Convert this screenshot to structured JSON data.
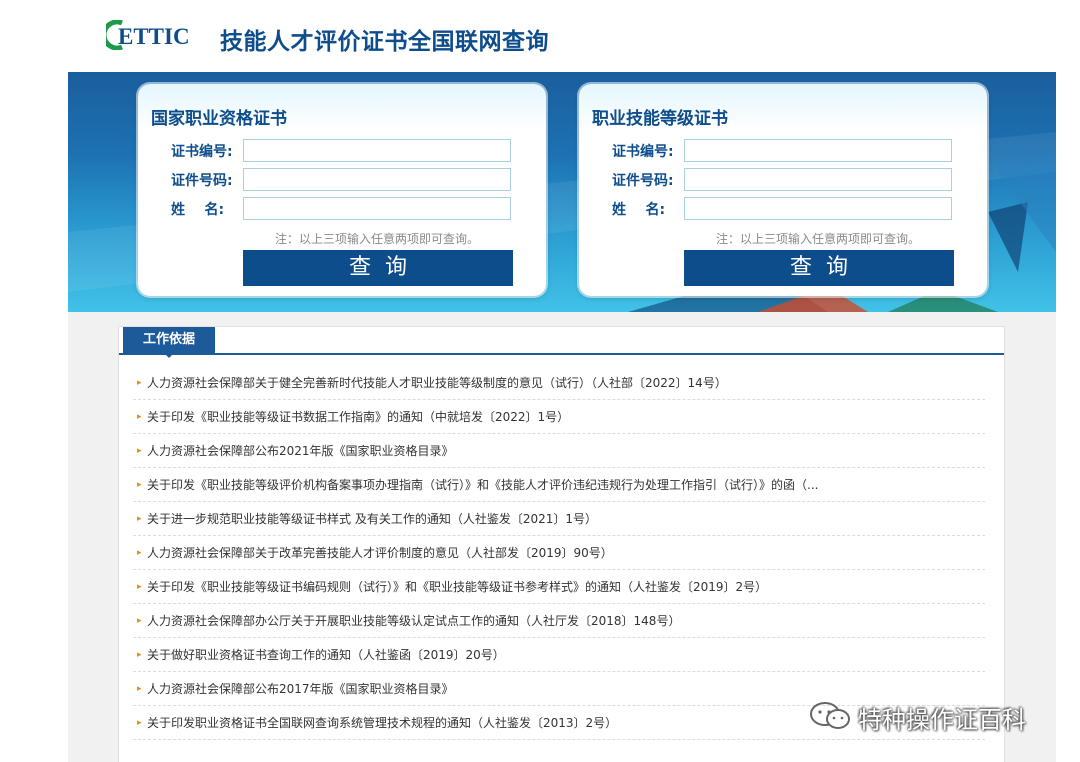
{
  "header": {
    "logo_text": "ETTIC",
    "title": "技能人才评价证书全国联网查询"
  },
  "cards": [
    {
      "title": "国家职业资格证书",
      "fields": [
        {
          "label": "证书编号:",
          "value": ""
        },
        {
          "label": "证件号码:",
          "value": ""
        },
        {
          "label": "姓    名:",
          "value": ""
        }
      ],
      "note": "注：以上三项输入任意两项即可查询。",
      "button_label": "查询"
    },
    {
      "title": "职业技能等级证书",
      "fields": [
        {
          "label": "证书编号:",
          "value": ""
        },
        {
          "label": "证件号码:",
          "value": ""
        },
        {
          "label": "姓    名:",
          "value": ""
        }
      ],
      "note": "注：以上三项输入任意两项即可查询。",
      "button_label": "查询"
    }
  ],
  "work_basis": {
    "tab_label": "工作依据",
    "items": [
      "人力资源社会保障部关于健全完善新时代技能人才职业技能等级制度的意见（试行）（人社部〔2022〕14号）",
      "关于印发《职业技能等级证书数据工作指南》的通知（中就培发〔2022〕1号）",
      "人力资源社会保障部公布2021年版《国家职业资格目录》",
      "关于印发《职业技能等级评价机构备案事项办理指南（试行）》和《技能人才评价违纪违规行为处理工作指引（试行）》的函（...",
      "关于进一步规范职业技能等级证书样式 及有关工作的通知（人社鉴发〔2021〕1号）",
      "人力资源社会保障部关于改革完善技能人才评价制度的意见（人社部发〔2019〕90号）",
      "关于印发《职业技能等级证书编码规则（试行）》和《职业技能等级证书参考样式》的通知（人社鉴发〔2019〕2号）",
      "人力资源社会保障部办公厅关于开展职业技能等级认定试点工作的通知（人社厅发〔2018〕148号）",
      "关于做好职业资格证书查询工作的通知（人社鉴函〔2019〕20号）",
      "人力资源社会保障部公布2017年版《国家职业资格目录》",
      "关于印发职业资格证书全国联网查询系统管理技术规程的通知（人社鉴发〔2013〕2号）"
    ]
  },
  "watermark": {
    "text": "特种操作证百科",
    "icon": "wechat-icon"
  },
  "colors": {
    "brand_blue": "#0e4d8c",
    "tab_blue": "#1c5a9a",
    "bullet_orange": "#e8891d",
    "banner_light": "#41c2e8"
  }
}
